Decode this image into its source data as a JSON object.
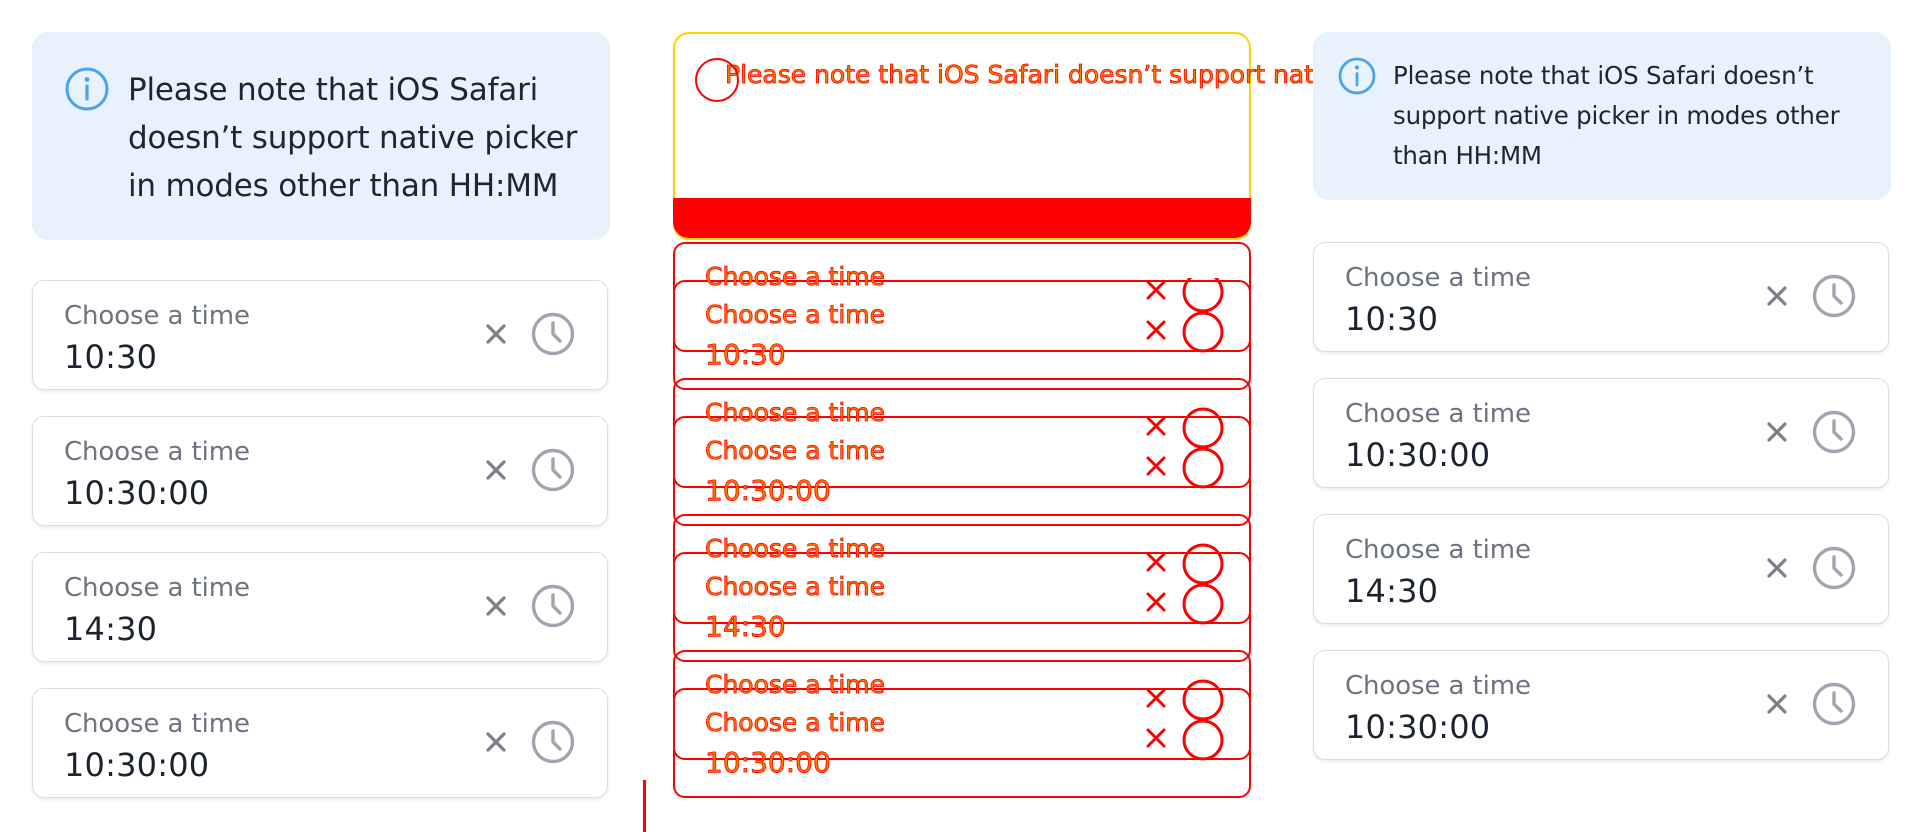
{
  "note": {
    "text": "Please note that iOS Safari doesn’t support native picker in modes other than HH:MM"
  },
  "fields": [
    {
      "label": "Choose a time",
      "value": "10:30"
    },
    {
      "label": "Choose a time",
      "value": "10:30:00"
    },
    {
      "label": "Choose a time",
      "value": "14:30"
    },
    {
      "label": "Choose a time",
      "value": "10:30:00"
    }
  ],
  "icons": {
    "info": "info-circle-icon",
    "clear": "close-icon",
    "clock": "clock-icon"
  },
  "colors": {
    "note_background": "#e8f2fd",
    "info_icon": "#4da3ea",
    "icon_gray": "#a0a5b0",
    "artifact_red": "#ff0000"
  }
}
